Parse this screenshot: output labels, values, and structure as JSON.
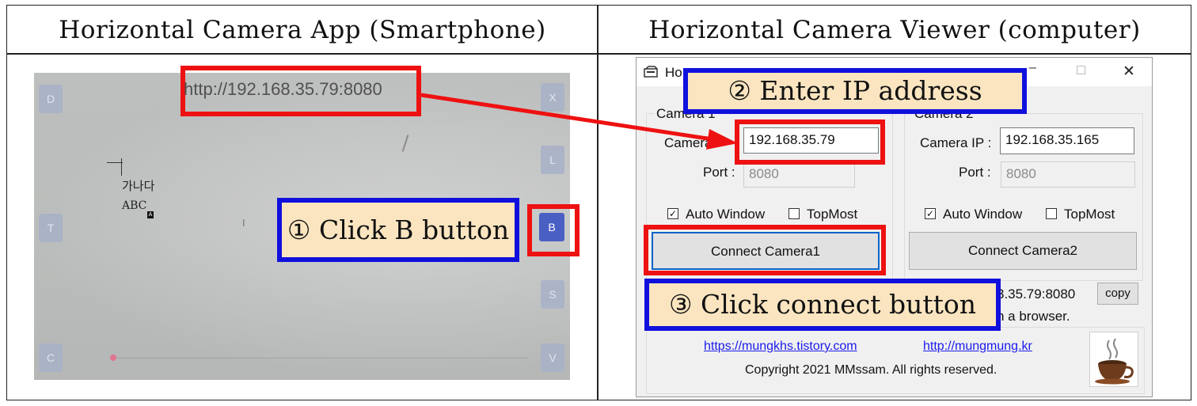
{
  "headers": {
    "left": "Horizontal Camera App (Smartphone)",
    "right": "Horizontal Camera Viewer (computer)"
  },
  "phone": {
    "url": "http://192.168.35.79:8080",
    "buttons_left": [
      "D",
      "T",
      "C"
    ],
    "buttons_right": [
      "X",
      "L",
      "B",
      "S",
      "V"
    ],
    "paper_korean": "가나다",
    "paper_abc": "ABC",
    "paper_badge": "A",
    "cursor_glyph": "I"
  },
  "callouts": {
    "step1": "① Click B button",
    "step2": "② Enter IP address",
    "step3": "③ Click connect button"
  },
  "viewer": {
    "title_partial": "Ho",
    "minimize": "–",
    "maximize": "□",
    "close": "✕",
    "camera1": {
      "group_label": "Camera 1",
      "ip_label": "Camera",
      "ip_value": "192.168.35.79",
      "port_label": "Port :",
      "port_value": "8080",
      "auto_window": "Auto Window",
      "topmost": "TopMost",
      "connect": "Connect Camera1"
    },
    "camera2": {
      "group_label": "Camera 2",
      "ip_label": "Camera IP :",
      "ip_value": "192.168.35.165",
      "port_label": "Port :",
      "port_value": "8080",
      "auto_window": "Auto Window",
      "topmost": "TopMost",
      "connect": "Connect Camera2"
    },
    "url_fragment": "3.35.79:8080",
    "copy": "copy",
    "browser_fragment": "n a browser.",
    "link1": "https://mungkhs.tistory.com",
    "link2": "http://mungmung.kr",
    "copyright": "Copyright 2021 MMssam. All rights reserved.",
    "coffee_icon": "coffee-cup-icon"
  },
  "colors": {
    "highlight_red": "#ee1111",
    "highlight_blue": "#1010dd",
    "callout_fill": "#fbe5c0",
    "phone_button_b": "#4a5fc4",
    "link": "#1a1aee"
  }
}
